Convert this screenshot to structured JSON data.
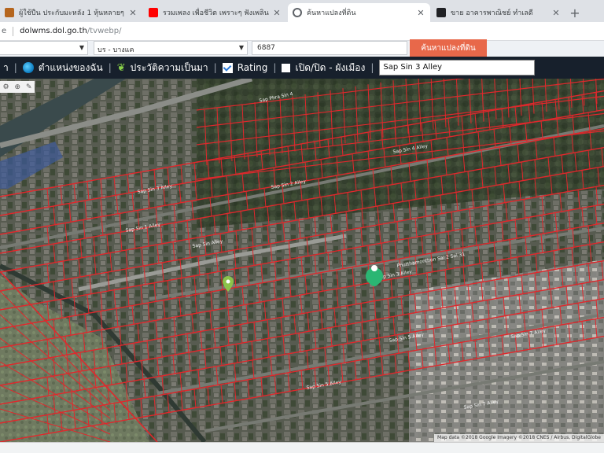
{
  "browser": {
    "tabs": [
      {
        "title": "ผู้ใช้ปืน ประกับมะหลัง 1 หุ้นหลายๆ",
        "icon_color": "#b5651d",
        "active": false
      },
      {
        "title": "รวมเพลง เพื่อชีวิต เพราะๆ ฟังเพลิน",
        "icon_color": "#ff0000",
        "active": false
      },
      {
        "title": "ค้นหาแปลงที่ดิน",
        "icon_color": "#5f6368",
        "active": true
      },
      {
        "title": "ขาย อาคารพาณิชย์ ทำเลดี",
        "icon_color": "#202124",
        "active": false
      }
    ],
    "new_tab": "+",
    "url_fragment": "e",
    "url_host": "dolwms.dol.go.th",
    "url_path": "/tvwebp/"
  },
  "search_form": {
    "district_value": "",
    "subdistrict_value": "บร - บางแค",
    "parcel_value": "6887",
    "search_button": "ค้นหาแปลงที่ดิน"
  },
  "toolbar": {
    "first_label": "า",
    "location_label": "ตำแหน่งของฉัน",
    "history_label": "ประวัติความเป็นมา",
    "rating_label": "Rating",
    "toggle_label": "เปิด/ปิด - ผังเมือง",
    "search_value": "Sap Sin 3 Alley"
  },
  "map": {
    "controls": [
      "⚙",
      "⊕",
      "✎"
    ],
    "attribution": "Map data ©2018 Google Imagery ©2018 CNES / Airbus, DigitalGlobe",
    "parcel_line_color": "#e0282c",
    "street_labels": [
      "Sap Phra Sin 4",
      "Sap Sin 3 Alley",
      "Sap Sin 2 Alley",
      "Sap Sin 1 Alley",
      "Sap Sin 4 Alley",
      "Sap Sin Alley",
      "Phutthamonthon Sai 2 Soi 31",
      "Sap Sin 3 Alley",
      "Sap Sin 5 Alley",
      "Sap Sin 7 Alley",
      "Sap Sin 5 Alley",
      "Sap Sin 7 Alley"
    ],
    "markers": [
      {
        "name": "selected-parcel-marker",
        "color": "#2bb673"
      },
      {
        "name": "current-location-marker",
        "color": "#8bc34a"
      }
    ]
  }
}
